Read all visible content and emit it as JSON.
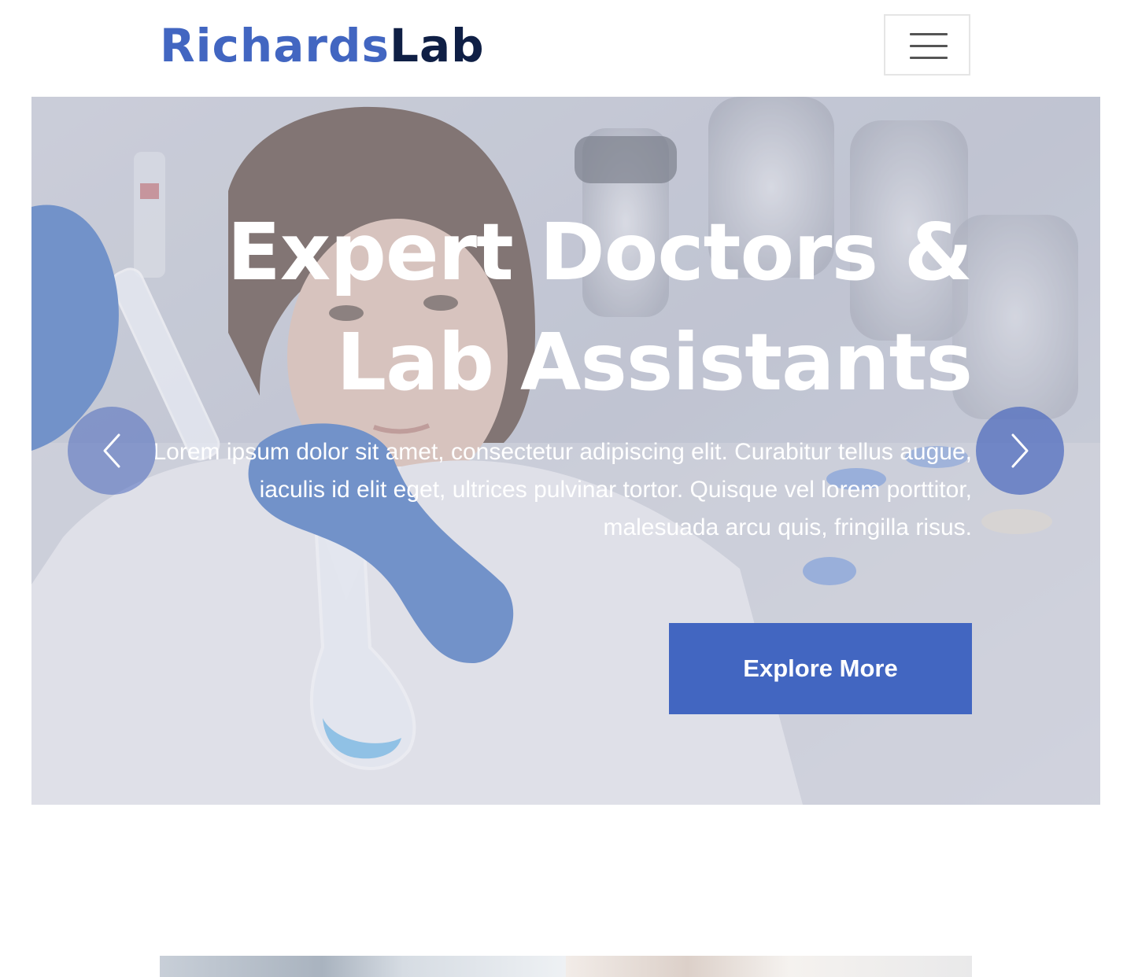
{
  "header": {
    "logo_part_a": "Richards",
    "logo_part_b": "Lab",
    "menu_toggle_label": "Toggle navigation"
  },
  "hero": {
    "title": "Expert Doctors & Lab Assistants",
    "text": "Lorem ipsum dolor sit amet, consectetur adipiscing elit. Curabitur tellus augue, iaculis id elit eget, ultrices pulvinar tortor. Quisque vel lorem porttitor, malesuada arcu quis, fringilla risus.",
    "button_label": "Explore More",
    "prev_icon": "chevron-left-icon",
    "next_icon": "chevron-right-icon"
  },
  "colors": {
    "brand_blue": "#4266c1",
    "brand_navy": "#0f1f45",
    "arrow_bg": "#4c6abe"
  }
}
